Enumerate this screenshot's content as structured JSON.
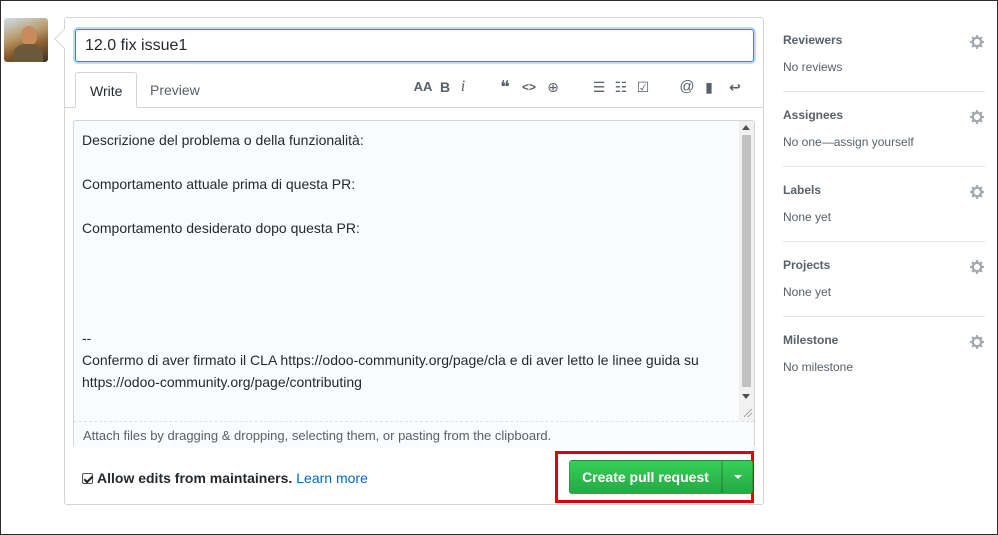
{
  "pr": {
    "title": "12.0 fix issue1",
    "tabs": [
      {
        "label": "Write"
      },
      {
        "label": "Preview"
      }
    ],
    "toolbar": {
      "heading": "AA",
      "bold": "B",
      "italic": "i",
      "quote": "❝",
      "code": "<>",
      "link": "⊕",
      "bullet_list": "☰",
      "numbered_list": "☷",
      "task_list": "☑",
      "mention": "@",
      "bookmark": "▮",
      "reply": "↩"
    },
    "body": "Descrizione del problema o della funzionalità:\n\nComportamento attuale prima di questa PR:\n\nComportamento desiderato dopo questa PR:\n\n\n\n\n--\nConfermo di aver firmato il CLA https://odoo-community.org/page/cla e di aver letto le linee guida su https://odoo-community.org/page/contributing",
    "attach_hint": "Attach files by dragging & dropping, selecting them, or pasting from the clipboard.",
    "allow_edits_label": "Allow edits from maintainers.",
    "allow_edits_checked": true,
    "learn_more": "Learn more",
    "submit_label": "Create pull request"
  },
  "sidebar": {
    "sections": [
      {
        "title": "Reviewers",
        "value": "No reviews"
      },
      {
        "title": "Assignees",
        "value": "No one—assign yourself"
      },
      {
        "title": "Labels",
        "value": "None yet"
      },
      {
        "title": "Projects",
        "value": "None yet"
      },
      {
        "title": "Milestone",
        "value": "No milestone"
      }
    ]
  },
  "colors": {
    "accent_blue": "#0366d6",
    "button_green": "#28a745",
    "highlight_red": "#e00000"
  }
}
